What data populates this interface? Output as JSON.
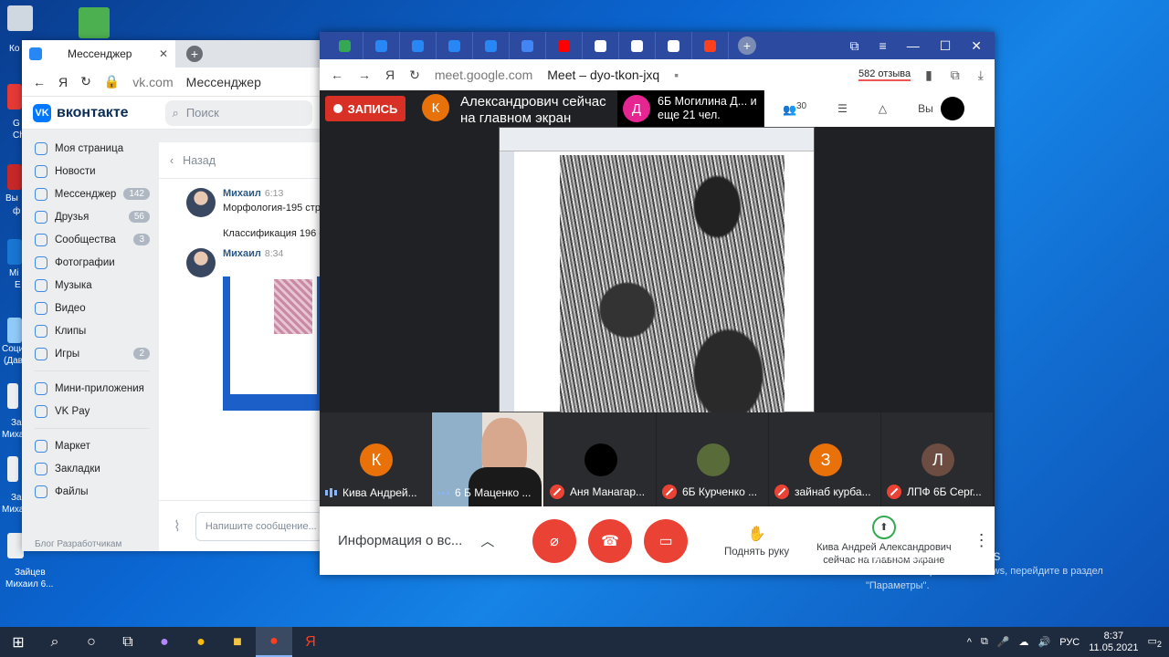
{
  "desktop": {
    "labels": [
      "Ко",
      "G",
      "Ch",
      "Вы",
      "ф",
      "Mi",
      "E",
      "Соци",
      "(Дав",
      "За",
      "Михай",
      "За",
      "Миха",
      "Зайцев",
      "Михаил 6..."
    ]
  },
  "vk": {
    "tab_title": "Мессенджер",
    "address_domain": "vk.com",
    "address_title": "Мессенджер",
    "logo": "вконтакте",
    "search_placeholder": "Поиск",
    "sidebar": [
      {
        "label": "Моя страница",
        "badge": ""
      },
      {
        "label": "Новости",
        "badge": ""
      },
      {
        "label": "Мессенджер",
        "badge": "142"
      },
      {
        "label": "Друзья",
        "badge": "56"
      },
      {
        "label": "Сообщества",
        "badge": "3"
      },
      {
        "label": "Фотографии",
        "badge": ""
      },
      {
        "label": "Музыка",
        "badge": ""
      },
      {
        "label": "Видео",
        "badge": ""
      },
      {
        "label": "Клипы",
        "badge": ""
      },
      {
        "label": "Игры",
        "badge": "2"
      }
    ],
    "sidebar2": [
      "Мини-приложения",
      "VK Pay"
    ],
    "sidebar3": [
      "Маркет",
      "Закладки",
      "Файлы"
    ],
    "back_label": "Назад",
    "messages": [
      {
        "name": "Михаил",
        "time": "6:13",
        "text1": "Морфология-195 стр.",
        "text2": "Классификация 196 с"
      },
      {
        "name": "Михаил",
        "time": "8:34"
      }
    ],
    "input_placeholder": "Напишите сообщение...",
    "footer": "Блог   Разработчикам"
  },
  "meet": {
    "address_domain": "meet.google.com",
    "address_title": "Meet – dyo-tkon-jxq",
    "reviews": "582 отзыва",
    "rec_label": "ЗАПИСЬ",
    "presenter_initial": "К",
    "presenter_text": "Александрович сейчас на главном экран",
    "d_initial": "Д",
    "d_text": "6Б Могилина Д... и еще 21 чел.",
    "people_count": "30",
    "you_label": "Вы",
    "tiles": [
      {
        "initial": "К",
        "color": "#e8710a",
        "name": "Кива Андрей...",
        "state": "speaking"
      },
      {
        "initial": "",
        "color": "",
        "name": "6 Б Маценко ...",
        "state": "video"
      },
      {
        "initial": "",
        "color": "#000000",
        "name": "Аня Манагар...",
        "state": "muted"
      },
      {
        "initial": "",
        "color": "#5a6b3a",
        "name": "6Б Курченко ...",
        "state": "muted"
      },
      {
        "initial": "З",
        "color": "#e8710a",
        "name": "зайнаб курба...",
        "state": "muted"
      },
      {
        "initial": "Л",
        "color": "#6d4c41",
        "name": "ЛПФ 6Б Серг...",
        "state": "muted"
      }
    ],
    "info_label": "Информация о вс...",
    "raise_hand": "Поднять руку",
    "presenting_line1": "Кива Андрей Александрович",
    "presenting_line2": "сейчас на главном экране"
  },
  "watermark": {
    "title": "Активация Windows",
    "line1": "Чтобы активировать Windows, перейдите в раздел",
    "line2": "\"Параметры\"."
  },
  "taskbar": {
    "lang": "РУС",
    "time": "8:37",
    "date": "11.05.2021",
    "notifications": "2"
  }
}
